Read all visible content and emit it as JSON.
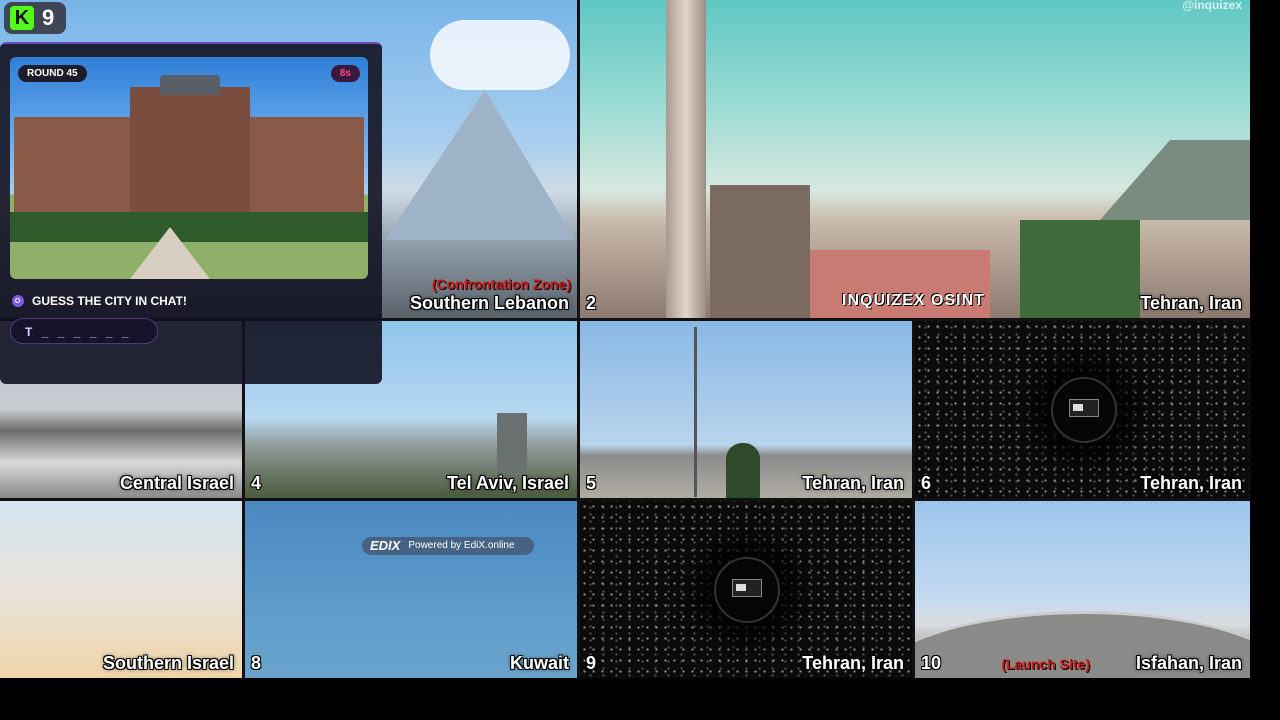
{
  "channel": {
    "logo_letter": "K",
    "viewer_count": "9"
  },
  "quiz": {
    "round_label": "ROUND 45",
    "timer": "8s",
    "prompt": "GUESS THE CITY IN CHAT!",
    "hint": "T _ _ _ _ _ _"
  },
  "branding": {
    "inquizex": "INQUIZEX",
    "osint": "OSINT",
    "handle": "@inquizex",
    "edix_logo": "EDIX",
    "edix_text": "Powered by EdiX.online"
  },
  "tiles": [
    {
      "num": "",
      "label": "Southern Lebanon",
      "note": "(Confrontation Zone)"
    },
    {
      "num": "2",
      "label": "Tehran, Iran",
      "note": ""
    },
    {
      "num": "",
      "label": "Central Israel",
      "note": ""
    },
    {
      "num": "4",
      "label": "Tel Aviv, Israel",
      "note": ""
    },
    {
      "num": "5",
      "label": "Tehran, Iran",
      "note": ""
    },
    {
      "num": "6",
      "label": "Tehran, Iran",
      "note": ""
    },
    {
      "num": "",
      "label": "Southern Israel",
      "note": ""
    },
    {
      "num": "8",
      "label": "Kuwait",
      "note": ""
    },
    {
      "num": "9",
      "label": "Tehran, Iran",
      "note": ""
    },
    {
      "num": "10",
      "label": "Isfahan, Iran",
      "note": "(Launch Site)"
    }
  ]
}
